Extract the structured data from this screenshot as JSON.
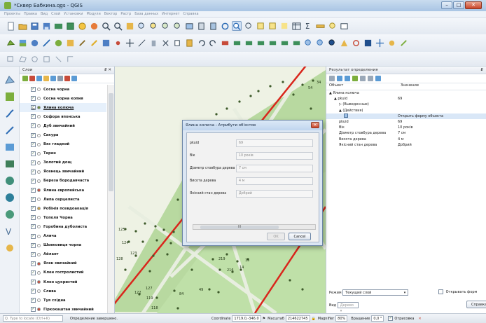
{
  "window": {
    "title": "*Сквер Бабкина.qgs - QGIS",
    "min": "–",
    "max": "□",
    "close": "✕"
  },
  "menu": [
    "Проекты",
    "Правка",
    "Вид",
    "Слой",
    "Установки",
    "Модули",
    "Вектор",
    "Растр",
    "База данных",
    "Интернет",
    "Справка"
  ],
  "layers_panel": {
    "title": "Слои",
    "controls": "₽ ✕",
    "items": [
      {
        "label": "Сосна чорна",
        "color": "#ffffff"
      },
      {
        "label": "Сосна чорна копия",
        "color": "#ffffff"
      },
      {
        "label": "Ялина колюча",
        "color": "#6b8f3a",
        "selected": true
      },
      {
        "label": "Софора японська",
        "color": "#ffffff"
      },
      {
        "label": "Дуб звичайний",
        "color": "#ffffff"
      },
      {
        "label": "Сакура",
        "color": "#ffffff"
      },
      {
        "label": "Вяз гладкий",
        "color": "#ffffff"
      },
      {
        "label": "Терен",
        "color": "#ffffff"
      },
      {
        "label": "Золотий дощ",
        "color": "#ffffff"
      },
      {
        "label": "Ясенець звичайний",
        "color": "#ffffff"
      },
      {
        "label": "Береза бородавчаста",
        "color": "#ffffff"
      },
      {
        "label": "Ялина європейська",
        "color": "#c74b3a"
      },
      {
        "label": "Липа серцелиста",
        "color": "#ffffff"
      },
      {
        "label": "Робінія псевдоакація",
        "color": "#c9a24a"
      },
      {
        "label": "Тополя Чорна",
        "color": "#ffffff"
      },
      {
        "label": "Горобина дуболиста",
        "color": "#ffffff"
      },
      {
        "label": "Алича",
        "color": "#ffffff"
      },
      {
        "label": "Шовковиця чорна",
        "color": "#ffffff"
      },
      {
        "label": "Айлант",
        "color": "#ffffff"
      },
      {
        "label": "Ясен звичайний",
        "color": "#c74b3a"
      },
      {
        "label": "Клен гостролистий",
        "color": "#ffffff"
      },
      {
        "label": "Клен цукристий",
        "color": "#c74b3a"
      },
      {
        "label": "Слива",
        "color": "#ffffff"
      },
      {
        "label": "Туя східна",
        "color": "#ffffff"
      },
      {
        "label": "Гіркокаштан звичайний",
        "color": "#c74b3a"
      }
    ]
  },
  "map": {
    "point_labels": [
      "34",
      "54",
      "125",
      "124",
      "123",
      "128",
      "127",
      "122",
      "119",
      "118",
      "84",
      "49",
      "219",
      "216",
      "14",
      "15"
    ]
  },
  "dialog": {
    "title": "Ялина колюча - Атрибути об'єктов",
    "fields": [
      {
        "label": "pkuid",
        "value": "69"
      },
      {
        "label": "Вік",
        "value": "10 років"
      },
      {
        "label": "Діаметр стовбура дерева",
        "value": "7 см"
      },
      {
        "label": "Висота дерева",
        "value": "4 м"
      },
      {
        "label": "Якісний стан дерева",
        "value": "Добрий"
      }
    ],
    "scroll_label": "III",
    "ok_label": "OK",
    "cancel_label": "Cancel"
  },
  "identify_panel": {
    "title": "Результат определения",
    "col_object": "Объект",
    "col_value": "Значение",
    "rows": [
      {
        "k": "▲ Ялина колюча",
        "v": "",
        "indent": 0
      },
      {
        "k": "▲ pkuid",
        "v": "69",
        "indent": 1
      },
      {
        "k": "▷ (Выведенные)",
        "v": "",
        "indent": 2
      },
      {
        "k": "▲ (Действия)",
        "v": "",
        "indent": 2
      },
      {
        "k": "",
        "v": "Открыть форму объекта",
        "indent": 3,
        "hl": true
      },
      {
        "k": "pkuid",
        "v": "69",
        "indent": 2
      },
      {
        "k": "Вік",
        "v": "10 років",
        "indent": 2
      },
      {
        "k": "Діаметр стовбура дерева",
        "v": "7 см",
        "indent": 2
      },
      {
        "k": "Висота дерева",
        "v": "4 м",
        "indent": 2
      },
      {
        "k": "Якісний стан дерева",
        "v": "Добрий",
        "indent": 2
      }
    ],
    "mode_label": "Режим",
    "mode_value": "Текущий слой",
    "open_form_label": "Открывать форм",
    "view_label": "Вид",
    "view_value": "Дерево",
    "help_label": "Справка"
  },
  "status": {
    "locate_placeholder": "Q. Type to locate (Ctrl+K)",
    "message": "Определение завершено.",
    "coord_label": "Coordinate",
    "coord_value": "1719.0,-346.0",
    "scale_label": "Масштаб",
    "scale_value": "214622745",
    "magnifier_label": "Magnifier",
    "magnifier_value": "80%",
    "rotation_label": "Вращение",
    "rotation_value": "0,0 °",
    "render_label": "Отрисовка"
  }
}
